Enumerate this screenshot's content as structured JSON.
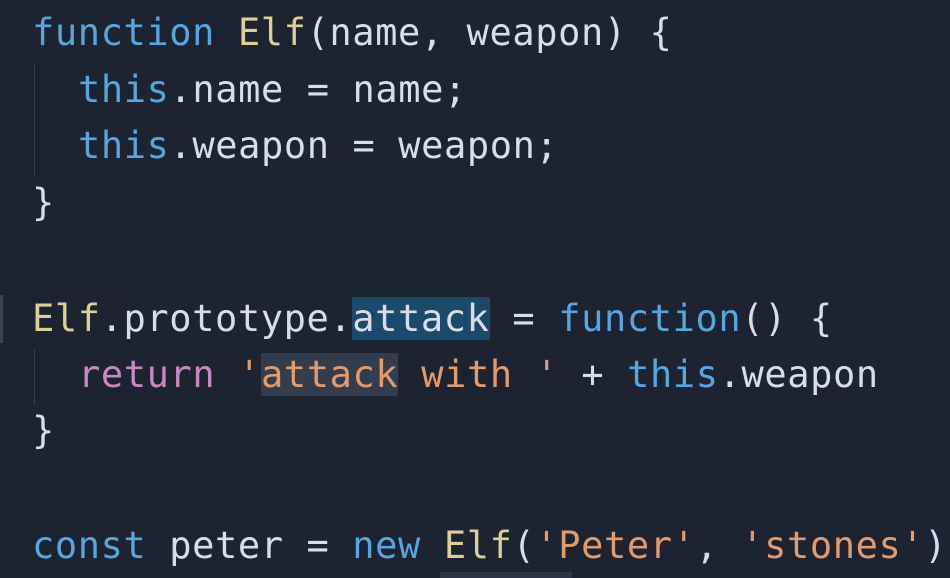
{
  "editor": {
    "lines": [
      {
        "tokens": [
          {
            "t": "function",
            "c": "kw"
          },
          {
            "t": " "
          },
          {
            "t": "Elf",
            "c": "fn"
          },
          {
            "t": "(name, weapon) {"
          }
        ]
      },
      {
        "tokens": [
          {
            "t": "this",
            "c": "kw"
          },
          {
            "t": ".name = name;"
          }
        ]
      },
      {
        "tokens": [
          {
            "t": "this",
            "c": "kw"
          },
          {
            "t": ".weapon = weapon;"
          }
        ]
      },
      {
        "tokens": [
          {
            "t": "}"
          }
        ]
      },
      {
        "tokens": [
          {
            "t": "Elf",
            "c": "fn"
          },
          {
            "t": ".prototype."
          },
          {
            "t": "attack",
            "hl": "word"
          },
          {
            "t": " = "
          },
          {
            "t": "function",
            "c": "kw"
          },
          {
            "t": "() {"
          }
        ]
      },
      {
        "tokens": [
          {
            "t": "return",
            "c": "ret"
          },
          {
            "t": " "
          },
          {
            "t": "'",
            "c": "str"
          },
          {
            "t": "attack",
            "c": "str",
            "hl": "str"
          },
          {
            "t": " with '",
            "c": "str"
          },
          {
            "t": " + "
          },
          {
            "t": "this",
            "c": "kw"
          },
          {
            "t": ".weapon"
          }
        ]
      },
      {
        "tokens": [
          {
            "t": "}"
          }
        ]
      },
      {
        "tokens": [
          {
            "t": "const",
            "c": "kw"
          },
          {
            "t": " peter = "
          },
          {
            "t": "new",
            "c": "kw"
          },
          {
            "t": " "
          },
          {
            "t": "Elf",
            "c": "fn"
          },
          {
            "t": "("
          },
          {
            "t": "'Peter'",
            "c": "str"
          },
          {
            "t": ", "
          },
          {
            "t": "'stones'",
            "c": "str"
          },
          {
            "t": ")"
          }
        ]
      }
    ]
  },
  "colors": {
    "background": "#1d2330",
    "keyword": "#56a6e0",
    "function_name": "#dcd097",
    "string": "#e29b6c",
    "return_keyword": "#c58ac4",
    "text": "#d8dee9",
    "word_highlight": "#1c4a6b"
  }
}
